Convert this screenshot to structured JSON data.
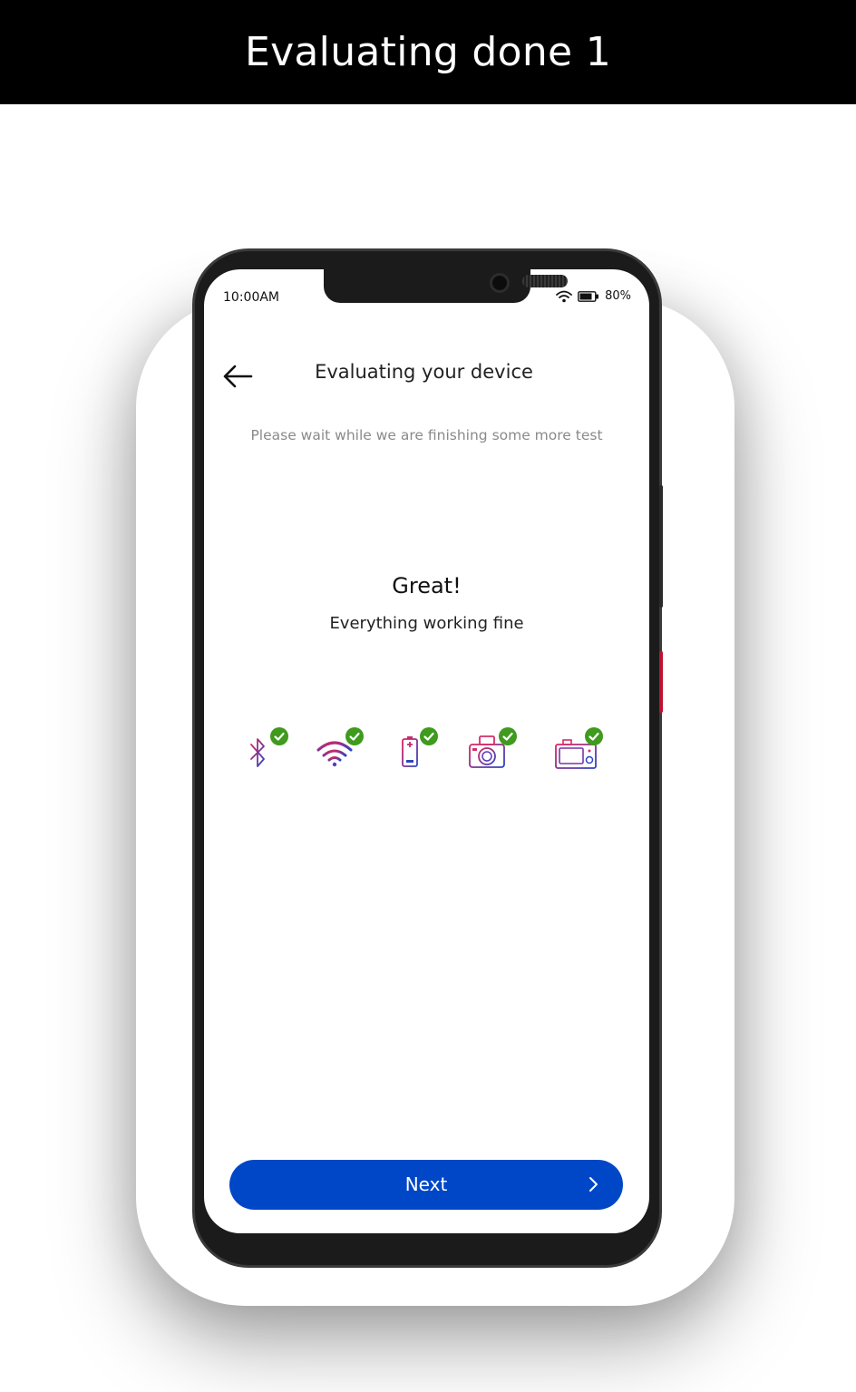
{
  "header": {
    "title": "Evaluating done 1"
  },
  "status_bar": {
    "time": "10:00AM",
    "battery": "80%"
  },
  "nav": {
    "title": "Evaluating your device"
  },
  "content": {
    "subtitle": "Please wait while we are finishing some more test",
    "result_title": "Great!",
    "result_message": "Everything working fine"
  },
  "checks": [
    {
      "icon": "bluetooth-icon",
      "status": "passed"
    },
    {
      "icon": "wifi-icon",
      "status": "passed"
    },
    {
      "icon": "battery-icon",
      "status": "passed"
    },
    {
      "icon": "camera-icon",
      "status": "passed"
    },
    {
      "icon": "rear-camera-icon",
      "status": "passed"
    }
  ],
  "actions": {
    "next_label": "Next"
  },
  "colors": {
    "primary_button": "#0047c7",
    "check_green": "#3f9a1e",
    "icon_gradient_start": "#e0245e",
    "icon_gradient_end": "#2b45c6"
  }
}
